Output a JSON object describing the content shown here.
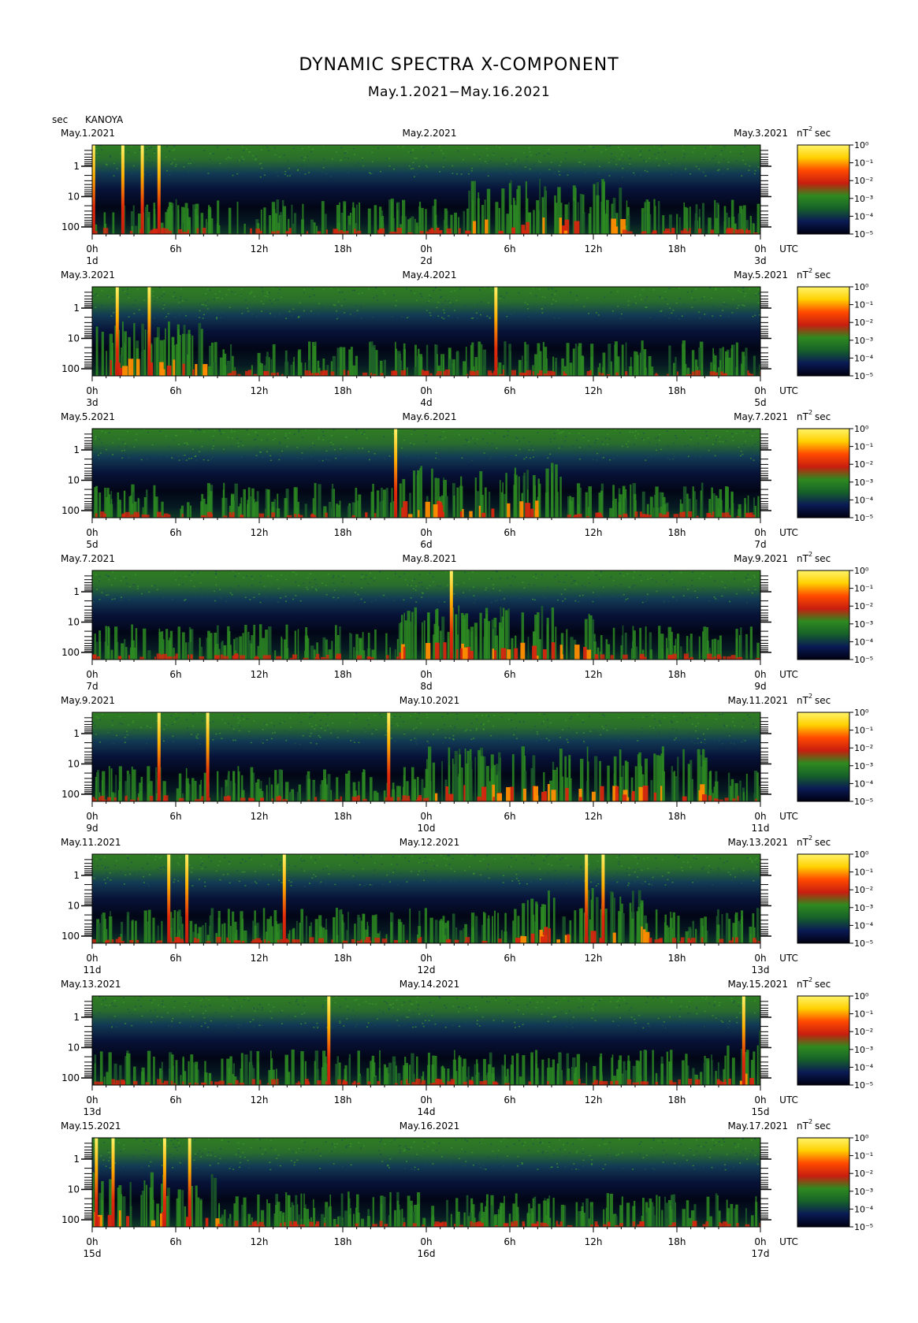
{
  "title": "DYNAMIC SPECTRA X-COMPONENT",
  "subtitle": "May.1.2021−May.16.2021",
  "y_unit": "sec",
  "station": "KANOYA",
  "utc_label": "UTC",
  "colorbar_unit": "nT",
  "colorbar_unit_exp": "2",
  "colorbar_unit_suffix": "sec",
  "colormap": [
    "#000010",
    "#0a1a55",
    "#16612a",
    "#2e8a1e",
    "#c81e0f",
    "#ff4a00",
    "#ffd000",
    "#fff36a"
  ],
  "chart_data": {
    "type": "heatmap",
    "x_axis": "Time (UTC), 48 h per panel",
    "y_axis": "Period (sec), log scale, inverted",
    "y_ticks": [
      "1",
      "10",
      "100"
    ],
    "x_ticks": [
      "0h",
      "6h",
      "12h",
      "18h",
      "0h",
      "6h",
      "12h",
      "18h",
      "0h"
    ],
    "colorbar_ticks": [
      "10⁰",
      "10⁻¹",
      "10⁻²",
      "10⁻³",
      "10⁻⁴",
      "10⁻⁵"
    ],
    "colorbar_range": [
      -5,
      0
    ],
    "panels": [
      {
        "left_date": "May.1.2021",
        "mid_date": "May.2.2021",
        "right_date": "May.3.2021",
        "day_labels": [
          "1d",
          "2d",
          "3d"
        ],
        "bursts_hours": [
          0.1,
          2.2,
          3.6,
          4.8
        ],
        "activity_hours": [
          [
            27,
            38
          ]
        ]
      },
      {
        "left_date": "May.3.2021",
        "mid_date": "May.4.2021",
        "right_date": "May.5.2021",
        "day_labels": [
          "3d",
          "4d",
          "5d"
        ],
        "bursts_hours": [
          1.8,
          4.1,
          29.0
        ],
        "activity_hours": [
          [
            0,
            8
          ]
        ]
      },
      {
        "left_date": "May.5.2021",
        "mid_date": "May.6.2021",
        "right_date": "May.7.2021",
        "day_labels": [
          "5d",
          "6d",
          "7d"
        ],
        "bursts_hours": [
          21.8
        ],
        "activity_hours": [
          [
            22,
            34
          ]
        ]
      },
      {
        "left_date": "May.7.2021",
        "mid_date": "May.8.2021",
        "right_date": "May.9.2021",
        "day_labels": [
          "7d",
          "8d",
          "9d"
        ],
        "bursts_hours": [
          25.8
        ],
        "activity_hours": [
          [
            22,
            36
          ]
        ]
      },
      {
        "left_date": "May.9.2021",
        "mid_date": "May.10.2021",
        "right_date": "May.11.2021",
        "day_labels": [
          "9d",
          "10d",
          "11d"
        ],
        "bursts_hours": [
          4.8,
          8.3,
          21.3
        ],
        "activity_hours": [
          [
            24,
            44
          ]
        ]
      },
      {
        "left_date": "May.11.2021",
        "mid_date": "May.12.2021",
        "right_date": "May.13.2021",
        "day_labels": [
          "11d",
          "12d",
          "13d"
        ],
        "bursts_hours": [
          5.5,
          6.8,
          13.8,
          35.5,
          36.7
        ],
        "activity_hours": [
          [
            30,
            40
          ]
        ]
      },
      {
        "left_date": "May.13.2021",
        "mid_date": "May.14.2021",
        "right_date": "May.15.2021",
        "day_labels": [
          "13d",
          "14d",
          "15d"
        ],
        "bursts_hours": [
          17.0,
          46.8
        ],
        "activity_hours": [
          [
            45.5,
            48
          ]
        ]
      },
      {
        "left_date": "May.15.2021",
        "mid_date": "May.16.2021",
        "right_date": "May.17.2021",
        "day_labels": [
          "15d",
          "16d",
          "17d"
        ],
        "bursts_hours": [
          0.3,
          1.5,
          5.2,
          7.0
        ],
        "activity_hours": [
          [
            0,
            9
          ]
        ]
      }
    ]
  }
}
